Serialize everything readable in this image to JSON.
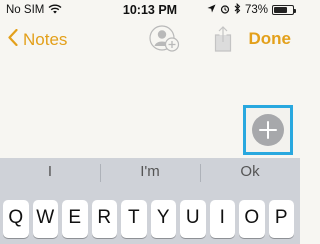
{
  "status": {
    "carrier": "No SIM",
    "time": "10:13 PM",
    "battery": "73%",
    "battery_level": 0.73
  },
  "nav": {
    "back_label": "Notes",
    "done_label": "Done"
  },
  "suggestions": [
    "I",
    "I'm",
    "Ok"
  ],
  "keyboard": {
    "row1": [
      "Q",
      "W",
      "E",
      "R",
      "T",
      "Y",
      "U",
      "I",
      "O",
      "P"
    ]
  },
  "colors": {
    "accent": "#e3a01b",
    "highlight": "#29a8df",
    "add_button": "#a7a8ab"
  }
}
